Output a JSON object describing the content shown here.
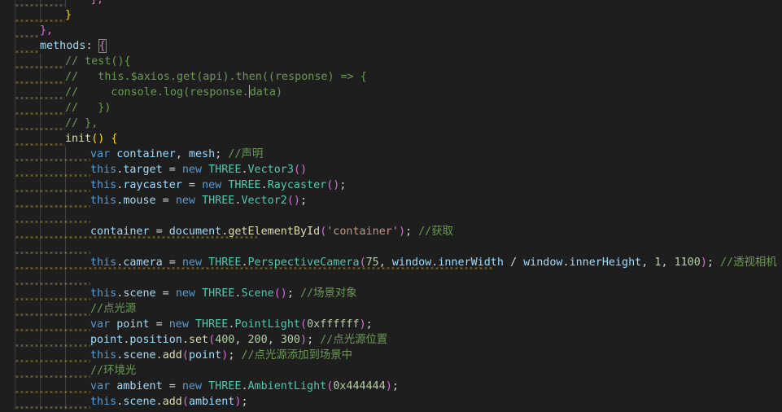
{
  "editor": {
    "colors": {
      "background": "#1e1e1e",
      "keyword": "#569cd6",
      "variable": "#9cdcfe",
      "class": "#4ec9b0",
      "function": "#dcdcaa",
      "string": "#ce9178",
      "number": "#b5cea8",
      "comment": "#6a9955",
      "punctuation": "#d4d4d4",
      "bracket_gold": "#ffd700",
      "bracket_purple": "#da70d6",
      "bracket_blue": "#179fff",
      "warning_squiggle": "#d7ba3d",
      "indent_guide": "#404040"
    },
    "lines": [
      {
        "indent": 3,
        "squig": [
          0,
          2
        ],
        "tokens": [
          {
            "t": "],",
            "c": "#da70d6"
          }
        ]
      },
      {
        "indent": 2,
        "squig": [
          0,
          2
        ],
        "tokens": [
          {
            "t": "}",
            "c": "#ffd700"
          }
        ]
      },
      {
        "indent": 1,
        "squig": [
          0,
          1
        ],
        "tokens": [
          {
            "t": "},",
            "c": "#da70d6"
          }
        ]
      },
      {
        "indent": 1,
        "squig": [
          0,
          1
        ],
        "tokens": [
          {
            "t": "methods",
            "c": "#9cdcfe"
          },
          {
            "t": ": ",
            "c": "#d4d4d4"
          },
          {
            "t": "{",
            "c": "#da70d6",
            "m": 1
          }
        ]
      },
      {
        "indent": 2,
        "squig": [
          0,
          2
        ],
        "tokens": [
          {
            "t": "// test(){",
            "c": "#6a9955"
          }
        ]
      },
      {
        "indent": 2,
        "squig": [
          0,
          2
        ],
        "tokens": [
          {
            "t": "//   this.$axios.get(api).then((response) => {",
            "c": "#6a9955"
          }
        ]
      },
      {
        "indent": 2,
        "squig": [
          0,
          2
        ],
        "tokens": [
          {
            "t": "//     console.log(response.",
            "c": "#6a9955"
          },
          {
            "cursor": 1
          },
          {
            "t": "data)",
            "c": "#6a9955"
          }
        ]
      },
      {
        "indent": 2,
        "squig": [
          0,
          2
        ],
        "tokens": [
          {
            "t": "//   })",
            "c": "#6a9955"
          }
        ]
      },
      {
        "indent": 2,
        "squig": [
          0,
          2
        ],
        "tokens": [
          {
            "t": "// },",
            "c": "#6a9955"
          }
        ]
      },
      {
        "indent": 2,
        "squig": [
          0,
          2
        ],
        "tokens": [
          {
            "t": "init",
            "c": "#dcdcaa"
          },
          {
            "t": "() ",
            "c": "#ffd700"
          },
          {
            "t": "{",
            "c": "#ffd700"
          }
        ]
      },
      {
        "indent": 3,
        "squig": [
          0,
          3
        ],
        "tokens": [
          {
            "t": "var ",
            "c": "#569cd6"
          },
          {
            "t": "container",
            "c": "#9cdcfe"
          },
          {
            "t": ", ",
            "c": "#d4d4d4"
          },
          {
            "t": "mesh",
            "c": "#9cdcfe"
          },
          {
            "t": "; ",
            "c": "#d4d4d4"
          },
          {
            "t": "//声明",
            "c": "#6a9955"
          }
        ]
      },
      {
        "indent": 3,
        "squig": [
          0,
          3
        ],
        "tokens": [
          {
            "t": "this",
            "c": "#569cd6"
          },
          {
            "t": ".",
            "c": "#d4d4d4"
          },
          {
            "t": "target",
            "c": "#9cdcfe"
          },
          {
            "t": " = ",
            "c": "#d4d4d4"
          },
          {
            "t": "new ",
            "c": "#569cd6"
          },
          {
            "t": "THREE",
            "c": "#4ec9b0"
          },
          {
            "t": ".",
            "c": "#d4d4d4"
          },
          {
            "t": "Vector3",
            "c": "#4ec9b0"
          },
          {
            "t": "()",
            "c": "#da70d6"
          }
        ]
      },
      {
        "indent": 3,
        "squig": [
          0,
          3
        ],
        "tokens": [
          {
            "t": "this",
            "c": "#569cd6"
          },
          {
            "t": ".",
            "c": "#d4d4d4"
          },
          {
            "t": "raycaster",
            "c": "#9cdcfe"
          },
          {
            "t": " = ",
            "c": "#d4d4d4"
          },
          {
            "t": "new ",
            "c": "#569cd6"
          },
          {
            "t": "THREE",
            "c": "#4ec9b0"
          },
          {
            "t": ".",
            "c": "#d4d4d4"
          },
          {
            "t": "Raycaster",
            "c": "#4ec9b0"
          },
          {
            "t": "()",
            "c": "#da70d6"
          },
          {
            "t": ";",
            "c": "#d4d4d4"
          }
        ]
      },
      {
        "indent": 3,
        "squig": [
          0,
          3
        ],
        "tokens": [
          {
            "t": "this",
            "c": "#569cd6"
          },
          {
            "t": ".",
            "c": "#d4d4d4"
          },
          {
            "t": "mouse",
            "c": "#9cdcfe"
          },
          {
            "t": " = ",
            "c": "#d4d4d4"
          },
          {
            "t": "new ",
            "c": "#569cd6"
          },
          {
            "t": "THREE",
            "c": "#4ec9b0"
          },
          {
            "t": ".",
            "c": "#d4d4d4"
          },
          {
            "t": "Vector2",
            "c": "#4ec9b0"
          },
          {
            "t": "()",
            "c": "#da70d6"
          },
          {
            "t": ";",
            "c": "#d4d4d4"
          }
        ]
      },
      {
        "indent": 3,
        "squig": [
          0,
          3
        ],
        "tokens": []
      },
      {
        "indent": 3,
        "squig": [
          0,
          41
        ],
        "tokens": [
          {
            "t": "container",
            "c": "#9cdcfe"
          },
          {
            "t": " = ",
            "c": "#d4d4d4"
          },
          {
            "t": "document",
            "c": "#9cdcfe"
          },
          {
            "t": ".",
            "c": "#d4d4d4"
          },
          {
            "t": "getElementById",
            "c": "#dcdcaa"
          },
          {
            "t": "(",
            "c": "#da70d6"
          },
          {
            "t": "'container'",
            "c": "#ce9178"
          },
          {
            "t": ")",
            "c": "#da70d6"
          },
          {
            "t": "; ",
            "c": "#d4d4d4"
          },
          {
            "t": "//获取",
            "c": "#6a9955"
          }
        ]
      },
      {
        "indent": 3,
        "squig": [
          0,
          3
        ],
        "tokens": []
      },
      {
        "indent": 3,
        "squig": [
          0,
          99
        ],
        "tokens": [
          {
            "t": "this",
            "c": "#569cd6"
          },
          {
            "t": ".",
            "c": "#d4d4d4"
          },
          {
            "t": "camera",
            "c": "#9cdcfe"
          },
          {
            "t": " = ",
            "c": "#d4d4d4"
          },
          {
            "t": "new ",
            "c": "#569cd6"
          },
          {
            "t": "THREE",
            "c": "#4ec9b0"
          },
          {
            "t": ".",
            "c": "#d4d4d4"
          },
          {
            "t": "PerspectiveCamera",
            "c": "#4ec9b0"
          },
          {
            "t": "(",
            "c": "#da70d6"
          },
          {
            "t": "75",
            "c": "#b5cea8"
          },
          {
            "t": ", ",
            "c": "#d4d4d4"
          },
          {
            "t": "window",
            "c": "#9cdcfe"
          },
          {
            "t": ".",
            "c": "#d4d4d4"
          },
          {
            "t": "innerWidth",
            "c": "#9cdcfe"
          },
          {
            "t": " / ",
            "c": "#d4d4d4"
          },
          {
            "t": "window",
            "c": "#9cdcfe"
          },
          {
            "t": ".",
            "c": "#d4d4d4"
          },
          {
            "t": "innerHeight",
            "c": "#9cdcfe"
          },
          {
            "t": ", ",
            "c": "#d4d4d4"
          },
          {
            "t": "1",
            "c": "#b5cea8"
          },
          {
            "t": ", ",
            "c": "#d4d4d4"
          },
          {
            "t": "1100",
            "c": "#b5cea8"
          },
          {
            "t": ")",
            "c": "#da70d6"
          },
          {
            "t": "; ",
            "c": "#d4d4d4"
          },
          {
            "t": "//透视相机",
            "c": "#6a9955"
          }
        ]
      },
      {
        "indent": 3,
        "squig": [
          0,
          3
        ],
        "tokens": []
      },
      {
        "indent": 3,
        "squig": [
          0,
          3
        ],
        "tokens": [
          {
            "t": "this",
            "c": "#569cd6"
          },
          {
            "t": ".",
            "c": "#d4d4d4"
          },
          {
            "t": "scene",
            "c": "#9cdcfe"
          },
          {
            "t": " = ",
            "c": "#d4d4d4"
          },
          {
            "t": "new ",
            "c": "#569cd6"
          },
          {
            "t": "THREE",
            "c": "#4ec9b0"
          },
          {
            "t": ".",
            "c": "#d4d4d4"
          },
          {
            "t": "Scene",
            "c": "#4ec9b0"
          },
          {
            "t": "()",
            "c": "#da70d6"
          },
          {
            "t": "; ",
            "c": "#d4d4d4"
          },
          {
            "t": "//场景对象",
            "c": "#6a9955"
          }
        ]
      },
      {
        "indent": 3,
        "squig": [
          0,
          3
        ],
        "tokens": [
          {
            "t": "//点光源",
            "c": "#6a9955"
          }
        ]
      },
      {
        "indent": 3,
        "squig": [
          0,
          3
        ],
        "tokens": [
          {
            "t": "var ",
            "c": "#569cd6"
          },
          {
            "t": "point",
            "c": "#9cdcfe"
          },
          {
            "t": " = ",
            "c": "#d4d4d4"
          },
          {
            "t": "new ",
            "c": "#569cd6"
          },
          {
            "t": "THREE",
            "c": "#4ec9b0"
          },
          {
            "t": ".",
            "c": "#d4d4d4"
          },
          {
            "t": "PointLight",
            "c": "#4ec9b0"
          },
          {
            "t": "(",
            "c": "#da70d6"
          },
          {
            "t": "0xffffff",
            "c": "#b5cea8"
          },
          {
            "t": ")",
            "c": "#da70d6"
          },
          {
            "t": ";",
            "c": "#d4d4d4"
          }
        ]
      },
      {
        "indent": 3,
        "squig": [
          0,
          3
        ],
        "tokens": [
          {
            "t": "point",
            "c": "#9cdcfe"
          },
          {
            "t": ".",
            "c": "#d4d4d4"
          },
          {
            "t": "position",
            "c": "#9cdcfe"
          },
          {
            "t": ".",
            "c": "#d4d4d4"
          },
          {
            "t": "set",
            "c": "#dcdcaa"
          },
          {
            "t": "(",
            "c": "#da70d6"
          },
          {
            "t": "400",
            "c": "#b5cea8"
          },
          {
            "t": ", ",
            "c": "#d4d4d4"
          },
          {
            "t": "200",
            "c": "#b5cea8"
          },
          {
            "t": ", ",
            "c": "#d4d4d4"
          },
          {
            "t": "300",
            "c": "#b5cea8"
          },
          {
            "t": ")",
            "c": "#da70d6"
          },
          {
            "t": "; ",
            "c": "#d4d4d4"
          },
          {
            "t": "//点光源位置",
            "c": "#6a9955"
          }
        ]
      },
      {
        "indent": 3,
        "squig": [
          0,
          3
        ],
        "tokens": [
          {
            "t": "this",
            "c": "#569cd6"
          },
          {
            "t": ".",
            "c": "#d4d4d4"
          },
          {
            "t": "scene",
            "c": "#9cdcfe"
          },
          {
            "t": ".",
            "c": "#d4d4d4"
          },
          {
            "t": "add",
            "c": "#dcdcaa"
          },
          {
            "t": "(",
            "c": "#da70d6"
          },
          {
            "t": "point",
            "c": "#9cdcfe"
          },
          {
            "t": ")",
            "c": "#da70d6"
          },
          {
            "t": "; ",
            "c": "#d4d4d4"
          },
          {
            "t": "//点光源添加到场景中",
            "c": "#6a9955"
          }
        ]
      },
      {
        "indent": 3,
        "squig": [
          0,
          3
        ],
        "tokens": [
          {
            "t": "//环境光",
            "c": "#6a9955"
          }
        ]
      },
      {
        "indent": 3,
        "squig": [
          0,
          3
        ],
        "tokens": [
          {
            "t": "var ",
            "c": "#569cd6"
          },
          {
            "t": "ambient",
            "c": "#9cdcfe"
          },
          {
            "t": " = ",
            "c": "#d4d4d4"
          },
          {
            "t": "new ",
            "c": "#569cd6"
          },
          {
            "t": "THREE",
            "c": "#4ec9b0"
          },
          {
            "t": ".",
            "c": "#d4d4d4"
          },
          {
            "t": "AmbientLight",
            "c": "#4ec9b0"
          },
          {
            "t": "(",
            "c": "#da70d6"
          },
          {
            "t": "0x444444",
            "c": "#b5cea8"
          },
          {
            "t": ")",
            "c": "#da70d6"
          },
          {
            "t": ";",
            "c": "#d4d4d4"
          }
        ]
      },
      {
        "indent": 3,
        "squig": [
          0,
          3
        ],
        "tokens": [
          {
            "t": "this",
            "c": "#569cd6"
          },
          {
            "t": ".",
            "c": "#d4d4d4"
          },
          {
            "t": "scene",
            "c": "#9cdcfe"
          },
          {
            "t": ".",
            "c": "#d4d4d4"
          },
          {
            "t": "add",
            "c": "#dcdcaa"
          },
          {
            "t": "(",
            "c": "#da70d6"
          },
          {
            "t": "ambient",
            "c": "#9cdcfe"
          },
          {
            "t": ")",
            "c": "#da70d6"
          },
          {
            "t": ";",
            "c": "#d4d4d4"
          }
        ]
      }
    ]
  }
}
